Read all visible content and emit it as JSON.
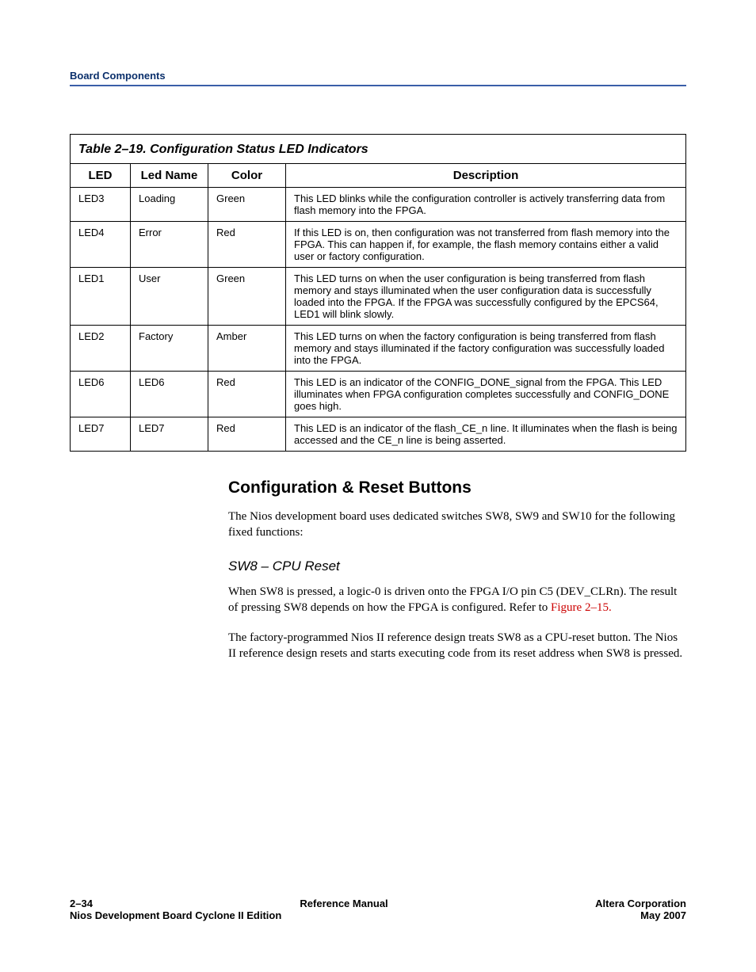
{
  "header": {
    "title": "Board Components"
  },
  "table": {
    "caption": "Table 2–19. Configuration Status LED Indicators",
    "columns": [
      "LED",
      "Led Name",
      "Color",
      "Description"
    ],
    "rows": [
      {
        "led": "LED3",
        "name": "Loading",
        "color": "Green",
        "desc": "This LED blinks while the configuration controller is actively transferring data from flash memory into the FPGA."
      },
      {
        "led": "LED4",
        "name": "Error",
        "color": "Red",
        "desc": "If this LED is on, then configuration was not transferred from flash memory into the FPGA. This can happen if, for example, the flash memory contains either a valid user or factory configuration."
      },
      {
        "led": "LED1",
        "name": "User",
        "color": "Green",
        "desc": "This LED turns on when the user configuration is being transferred from flash memory and stays illuminated when the user configuration data is successfully loaded into the FPGA. If the FPGA was successfully configured by the EPCS64, LED1 will blink slowly."
      },
      {
        "led": "LED2",
        "name": "Factory",
        "color": "Amber",
        "desc": "This LED turns on when the factory configuration is being transferred from flash memory and stays illuminated if the factory configuration was successfully loaded into the FPGA."
      },
      {
        "led": "LED6",
        "name": "LED6",
        "color": "Red",
        "desc": "This LED is an indicator of the CONFIG_DONE_signal from the FPGA. This LED illuminates when FPGA configuration completes successfully and CONFIG_DONE goes high."
      },
      {
        "led": "LED7",
        "name": "LED7",
        "color": "Red",
        "desc": "This LED is an indicator of the flash_CE_n line. It illuminates when the flash is being accessed and the CE_n line is being asserted."
      }
    ]
  },
  "section": {
    "heading": "Configuration & Reset Buttons",
    "intro": "The Nios development board uses dedicated switches SW8, SW9 and SW10 for the following fixed functions:",
    "sub_heading": "SW8 – CPU Reset",
    "p1_a": "When SW8 is pressed, a logic-0 is driven onto the FPGA I/O pin C5 (DEV_CLRn). The result of pressing SW8 depends on how the FPGA is configured. Refer to ",
    "p1_link": "Figure 2–15.",
    "p2": "The factory-programmed Nios II reference design treats SW8 as a CPU-reset button. The Nios II reference design resets and starts executing code from its reset address when SW8 is pressed."
  },
  "footer": {
    "page": "2–34",
    "center1": "Reference Manual",
    "right1": "Altera Corporation",
    "left2": "Nios Development Board Cyclone II Edition",
    "right2": "May 2007"
  }
}
